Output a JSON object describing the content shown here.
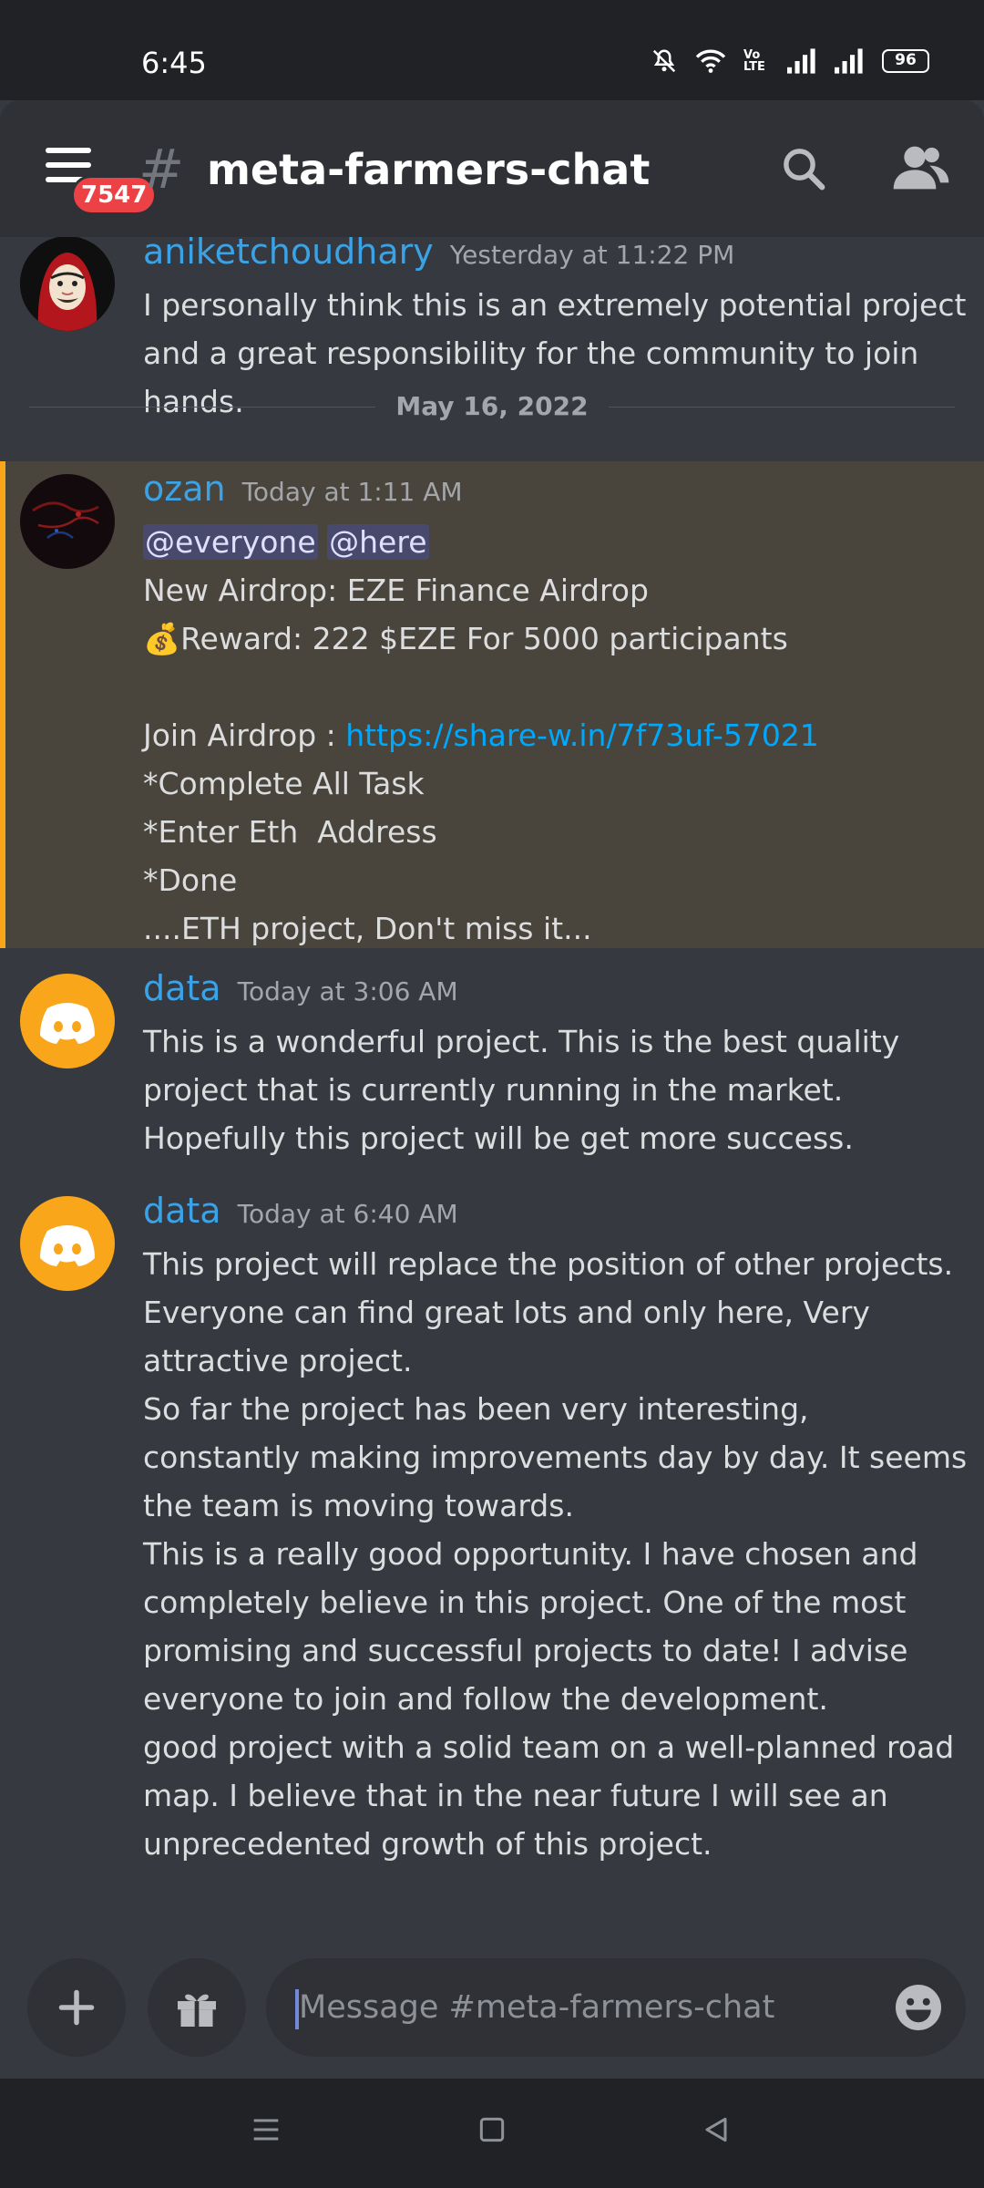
{
  "status_bar": {
    "time": "6:45",
    "network_label": "Vo LTE",
    "battery": "96"
  },
  "header": {
    "notification_count": "7547",
    "channel_name": "meta-farmers-chat"
  },
  "messages": [
    {
      "author": "aniketchoudhary",
      "timestamp": "Yesterday at 11:22 PM",
      "lines": [
        "I personally think this is an extremely potential project and a great responsibility for the community to join hands."
      ]
    },
    {
      "author": "ozan",
      "timestamp": "Today at 1:11 AM",
      "mentions": [
        "@everyone",
        "@here"
      ],
      "lines": [
        "New Airdrop: EZE Finance Airdrop",
        "💰Reward: 222 $EZE For 5000 participants"
      ],
      "join_prefix": "Join Airdrop : ",
      "join_link": "https://share-w.in/7f73uf-57021",
      "tail_lines": [
        "*Complete All Task",
        "*Enter Eth  Address",
        "*Done",
        "....ETH project, Don't miss it..."
      ]
    },
    {
      "author": "data",
      "timestamp": "Today at 3:06 AM",
      "lines": [
        "This is a wonderful project. This is the best quality project that is currently running in the market. Hopefully this project will be get more success."
      ]
    },
    {
      "author": "data",
      "timestamp": "Today at 6:40 AM",
      "lines": [
        "This project will replace the position of other projects. Everyone can find great lots and only here, Very attractive project.",
        "So far the project has been very interesting, constantly making improvements day by day. It seems the team is moving towards.",
        "This is a really good opportunity. I have chosen and completely believe in this project. One of the most promising and successful projects to date! I advise everyone to join and follow the development.",
        "good project with a solid team on a well-planned road map. I believe that in the near future I will see an unprecedented growth of this project."
      ]
    }
  ],
  "date_divider": "May 16, 2022",
  "composer": {
    "placeholder": "Message #meta-farmers-chat"
  },
  "colors": {
    "background": "#36393f",
    "header": "#2f3136",
    "author": "#3ba2e6",
    "mention_highlight": "#49443c",
    "mention_bar": "#faa61a",
    "link": "#00a8fc",
    "badge": "#ed4245",
    "discord_avatar": "#faa61a"
  },
  "icons": {
    "menu": "hamburger-menu-icon",
    "search": "search-icon",
    "members": "members-icon",
    "add": "plus-icon",
    "gift": "gift-icon",
    "emoji": "emoji-icon"
  }
}
